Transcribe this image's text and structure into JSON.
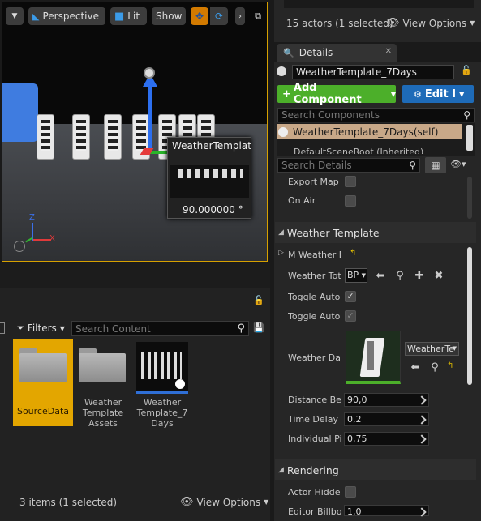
{
  "viewport": {
    "perspective_label": "Perspective",
    "lit_label": "Lit",
    "show_label": "Show",
    "tooltip_title": "WeatherTemplate",
    "tooltip_value": "90.000000 °"
  },
  "outliner": {
    "actors_status": "15 actors (1 selected)",
    "view_options": "View Options"
  },
  "details": {
    "tab_label": "Details",
    "actor_name": "WeatherTemplate_7Days",
    "add_component": "Add Component",
    "edit_blueprint": "Edit I",
    "search_components_placeholder": "Search Components",
    "component_self": "WeatherTemplate_7Days(self)",
    "component_root": "DefaultSceneRoot (Inherited)",
    "search_details_placeholder": "Search Details",
    "props": {
      "export_map": "Export Map N",
      "on_air": "On Air",
      "section_weather_template": "Weather Template",
      "m_weather": "M Weather D",
      "weather_tote": "Weather Tote",
      "weather_tote_value": "BP",
      "toggle_auto_1": "Toggle Auto U",
      "toggle_auto_2": "Toggle Auto U",
      "weather_data": "Weather Data",
      "weather_data_value": "WeatherTe",
      "distance_between": "Distance Bet",
      "distance_between_value": "90,0",
      "time_delay": "Time Delay B",
      "time_delay_value": "0,2",
      "individual_pil": "Individual Pil",
      "individual_pil_value": "0,75",
      "section_rendering": "Rendering",
      "actor_hidden": "Actor Hidden",
      "editor_billboard": "Editor Billboa",
      "editor_billboard_value": "1,0"
    }
  },
  "content_browser": {
    "filters_label": "Filters",
    "search_placeholder": "Search Content",
    "assets": [
      {
        "label": "SourceData"
      },
      {
        "label": "Weather Template Assets"
      },
      {
        "label": "Weather Template_7 Days"
      }
    ],
    "status": "3 items (1 selected)",
    "view_options": "View Options"
  },
  "colors": {
    "selection": "#e3a600",
    "add_component_green": "#4caf2a",
    "edit_blue": "#1e6bb8",
    "component_self_bg": "#c8a888"
  }
}
